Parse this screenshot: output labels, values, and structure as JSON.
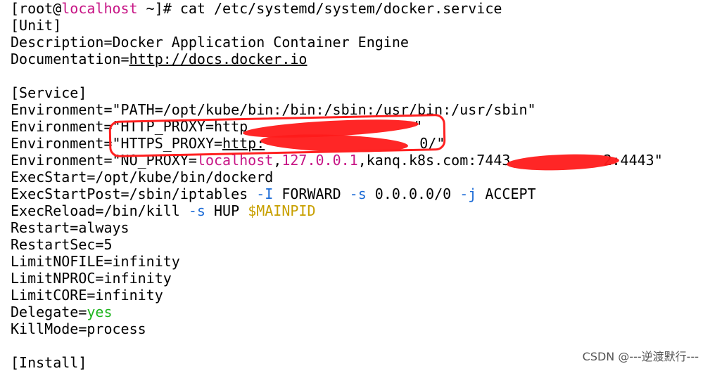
{
  "prompt": {
    "open": "[root@",
    "host": "localhost",
    "rest": " ~]# ",
    "command": "cat /etc/systemd/system/docker.service"
  },
  "unit": {
    "header": "[Unit]",
    "description": "Description=Docker Application Container Engine",
    "doc_key": "Documentation=",
    "doc_url": "http://docs.docker.io"
  },
  "service": {
    "header": "[Service]",
    "env_path": "Environment=\"PATH=/opt/kube/bin:/bin:/sbin:/usr/bin:/usr/sbin\"",
    "env_http_key": "Environment=\"HTTP_PROXY=",
    "env_http_val": "http",
    "env_http_end": "\"",
    "env_https_key": "Environment=\"HTTPS_PROXY=",
    "env_https_val": "http:",
    "env_https_end": "0/\"",
    "env_noproxy_key": "Environment=\"NO_PROXY=",
    "env_noproxy_host": "localhost",
    "env_noproxy_sep": ",",
    "env_noproxy_ip": "127.0.0.1",
    "env_noproxy_rest": ",kanq.k8s.com:7443",
    "env_noproxy_tail": "2:4443\"",
    "exec_start": "ExecStart=/opt/kube/bin/dockerd",
    "exec_start_post_a": "ExecStartPost=/sbin/iptables ",
    "exec_start_post_i": "-I",
    "exec_start_post_b": " FORWARD ",
    "exec_start_post_s": "-s",
    "exec_start_post_c": " 0.0.0.0/0 ",
    "exec_start_post_j": "-j",
    "exec_start_post_d": " ACCEPT",
    "exec_reload_a": "ExecReload=/bin/kill ",
    "exec_reload_s": "-s",
    "exec_reload_b": " HUP ",
    "exec_reload_var": "$MAINPID",
    "restart": "Restart=always",
    "restart_sec": "RestartSec=5",
    "limit_nofile": "LimitNOFILE=infinity",
    "limit_nproc": "LimitNPROC=infinity",
    "limit_core": "LimitCORE=infinity",
    "delegate_key": "Delegate=",
    "delegate_val": "yes",
    "kill_mode": "KillMode=process"
  },
  "install": {
    "header": "[Install]"
  },
  "watermark": "CSDN @---逆渡默行---",
  "colors": {
    "host": "#c71585",
    "flag": "#1a6ad6",
    "variable": "#c8a000",
    "yes": "#1db41d",
    "redaction": "#ff1a1a"
  }
}
